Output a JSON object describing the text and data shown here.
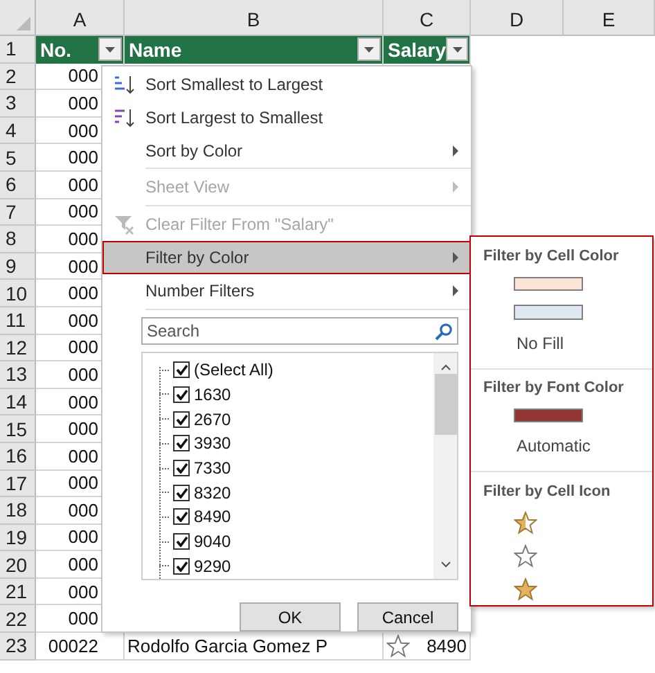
{
  "columns": [
    "A",
    "B",
    "C",
    "D",
    "E"
  ],
  "header_row": {
    "number": "1",
    "cells": [
      "No.",
      "Name",
      "Salary"
    ]
  },
  "rows": [
    {
      "number": "2",
      "cells": [
        "000"
      ]
    },
    {
      "number": "3",
      "cells": [
        "000"
      ]
    },
    {
      "number": "4",
      "cells": [
        "000"
      ]
    },
    {
      "number": "5",
      "cells": [
        "000"
      ]
    },
    {
      "number": "6",
      "cells": [
        "000"
      ]
    },
    {
      "number": "7",
      "cells": [
        "000"
      ]
    },
    {
      "number": "8",
      "cells": [
        "000"
      ]
    },
    {
      "number": "9",
      "cells": [
        "000"
      ]
    },
    {
      "number": "10",
      "cells": [
        "000"
      ]
    },
    {
      "number": "11",
      "cells": [
        "000"
      ]
    },
    {
      "number": "12",
      "cells": [
        "000"
      ]
    },
    {
      "number": "13",
      "cells": [
        "000"
      ]
    },
    {
      "number": "14",
      "cells": [
        "000"
      ]
    },
    {
      "number": "15",
      "cells": [
        "000"
      ]
    },
    {
      "number": "16",
      "cells": [
        "000"
      ]
    },
    {
      "number": "17",
      "cells": [
        "000"
      ]
    },
    {
      "number": "18",
      "cells": [
        "000"
      ]
    },
    {
      "number": "19",
      "cells": [
        "000"
      ]
    },
    {
      "number": "20",
      "cells": [
        "000"
      ]
    },
    {
      "number": "21",
      "cells": [
        "000"
      ]
    },
    {
      "number": "22",
      "cells": [
        "000"
      ]
    },
    {
      "number": "23",
      "cells": [
        "00022",
        "Rodolfo Garcia Gomez P",
        "8490"
      ],
      "star_icon": true
    }
  ],
  "filter_menu": {
    "items": [
      {
        "kind": "sort-asc",
        "label": "Sort Smallest to Largest",
        "disabled": false,
        "submenu": false,
        "selected": false,
        "separator_after": false
      },
      {
        "kind": "sort-desc",
        "label": "Sort Largest to Smallest",
        "disabled": false,
        "submenu": false,
        "selected": false,
        "separator_after": false
      },
      {
        "kind": "plain",
        "label": "Sort by Color",
        "disabled": false,
        "submenu": true,
        "selected": false,
        "separator_after": true
      },
      {
        "kind": "plain",
        "label": "Sheet View",
        "disabled": true,
        "submenu": true,
        "selected": false,
        "separator_after": true
      },
      {
        "kind": "clear-filter",
        "label": "Clear Filter From \"Salary\"",
        "disabled": true,
        "submenu": false,
        "selected": false,
        "separator_after": false
      },
      {
        "kind": "plain",
        "label": "Filter by Color",
        "disabled": false,
        "submenu": true,
        "selected": true,
        "separator_after": false
      },
      {
        "kind": "plain",
        "label": "Number Filters",
        "disabled": false,
        "submenu": true,
        "selected": false,
        "separator_after": true
      }
    ],
    "search": {
      "placeholder": "Search"
    },
    "values": [
      {
        "label": "(Select All)",
        "checked": true
      },
      {
        "label": "1630",
        "checked": true
      },
      {
        "label": "2670",
        "checked": true
      },
      {
        "label": "3930",
        "checked": true
      },
      {
        "label": "7330",
        "checked": true
      },
      {
        "label": "8320",
        "checked": true
      },
      {
        "label": "8490",
        "checked": true
      },
      {
        "label": "9040",
        "checked": true
      },
      {
        "label": "9290",
        "checked": true
      }
    ],
    "buttons": [
      "OK",
      "Cancel"
    ]
  },
  "color_submenu": {
    "sections": [
      {
        "title": "Filter by Cell Color",
        "entries": [
          {
            "kind": "swatch",
            "color": "#fce4d6"
          },
          {
            "kind": "swatch",
            "color": "#dde8f2"
          },
          {
            "kind": "text",
            "label": "No Fill"
          }
        ]
      },
      {
        "title": "Filter by Font Color",
        "entries": [
          {
            "kind": "swatch",
            "color": "#943634"
          },
          {
            "kind": "text",
            "label": "Automatic"
          }
        ]
      },
      {
        "title": "Filter by Cell Icon",
        "entries": [
          {
            "kind": "star-half"
          },
          {
            "kind": "star-empty"
          },
          {
            "kind": "star-full"
          }
        ]
      }
    ]
  }
}
